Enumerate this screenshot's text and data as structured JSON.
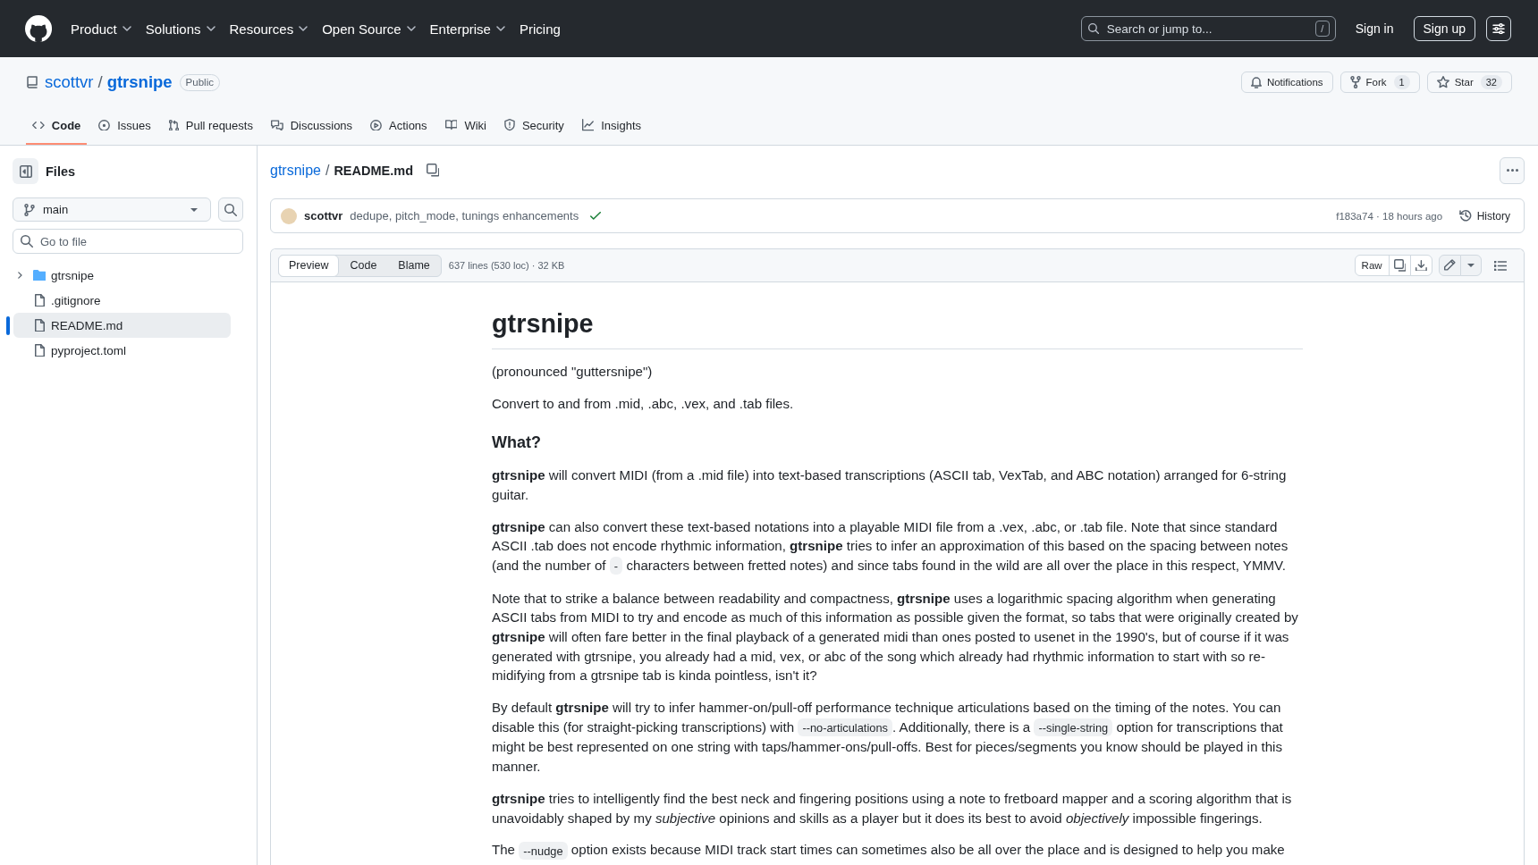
{
  "header": {
    "nav": [
      {
        "label": "Product",
        "dropdown": true
      },
      {
        "label": "Solutions",
        "dropdown": true
      },
      {
        "label": "Resources",
        "dropdown": true
      },
      {
        "label": "Open Source",
        "dropdown": true
      },
      {
        "label": "Enterprise",
        "dropdown": true
      },
      {
        "label": "Pricing",
        "dropdown": false
      }
    ],
    "search": {
      "placeholder": "Search or jump to...",
      "shortcut": "/"
    },
    "sign_in": "Sign in",
    "sign_up": "Sign up"
  },
  "repo": {
    "owner": "scottvr",
    "separator": "/",
    "name": "gtrsnipe",
    "visibility": "Public",
    "actions": [
      {
        "kind": "notifications",
        "label": "Notifications"
      },
      {
        "kind": "fork",
        "label": "Fork",
        "count": "1"
      },
      {
        "kind": "star",
        "label": "Star",
        "count": "32"
      }
    ]
  },
  "tabs": [
    {
      "kind": "code",
      "label": "Code",
      "selected": true
    },
    {
      "kind": "issues",
      "label": "Issues",
      "selected": false
    },
    {
      "kind": "pull_requests",
      "label": "Pull requests",
      "selected": false
    },
    {
      "kind": "discussions",
      "label": "Discussions",
      "selected": false
    },
    {
      "kind": "actions",
      "label": "Actions",
      "selected": false
    },
    {
      "kind": "wiki",
      "label": "Wiki",
      "selected": false
    },
    {
      "kind": "security",
      "label": "Security",
      "selected": false
    },
    {
      "kind": "insights",
      "label": "Insights",
      "selected": false
    }
  ],
  "sidebar": {
    "title": "Files",
    "branch": "main",
    "filter": {
      "placeholder": "Go to file"
    },
    "tree": [
      {
        "kind": "folder",
        "name": "gtrsnipe",
        "expanded": false,
        "selected": false
      },
      {
        "kind": "file",
        "name": ".gitignore",
        "selected": false
      },
      {
        "kind": "file",
        "name": "README.md",
        "selected": true
      },
      {
        "kind": "file",
        "name": "pyproject.toml",
        "selected": false
      }
    ]
  },
  "file": {
    "breadcrumb": {
      "repo": "gtrsnipe",
      "separator": "/",
      "file": "README.md"
    },
    "commit": {
      "author": "scottvr",
      "message": "dedupe, pitch_mode, tunings enhancements",
      "checks_passed": true,
      "meta": "f183a74 · 18 hours ago",
      "history": "History"
    },
    "view_modes": [
      {
        "label": "Preview",
        "selected": true
      },
      {
        "label": "Code",
        "selected": false
      },
      {
        "label": "Blame",
        "selected": false
      }
    ],
    "stats": "637 lines (530 loc) · 32 KB",
    "raw": "Raw"
  },
  "readme": [
    {
      "kind": "h1",
      "text": "gtrsnipe"
    },
    {
      "kind": "p",
      "parts": [
        {
          "kind": "text",
          "text": "(pronounced \"guttersnipe\")"
        }
      ]
    },
    {
      "kind": "p",
      "parts": [
        {
          "kind": "text",
          "text": "Convert to and from .mid, .abc, .vex, and .tab files."
        }
      ]
    },
    {
      "kind": "h2",
      "text": "What?"
    },
    {
      "kind": "p",
      "parts": [
        {
          "kind": "text",
          "text": "**gtrsnipe** will convert MIDI (from a .mid file) into text-based transcriptions (ASCII tab, VexTab, and ABC notation) arranged for 6-string guitar."
        }
      ]
    },
    {
      "kind": "p",
      "parts": [
        {
          "kind": "text",
          "text": "**gtrsnipe** can also convert these text-based notations into a playable MIDI file from a .vex, .abc, or .tab file. Note that since standard ASCII .tab does not encode rhythmic information, **gtrsnipe** tries to infer an approximation of this based on the spacing between notes (and the number of "
        },
        {
          "kind": "code",
          "text": "-"
        },
        {
          "kind": "text",
          "text": " characters between fretted notes) and since tabs found in the wild are all over the place in this respect, YMMV."
        }
      ]
    },
    {
      "kind": "p",
      "parts": [
        {
          "kind": "text",
          "text": "Note that to strike a balance between readability and compactness, **gtrsnipe** uses a logarithmic spacing algorithm when generating ASCII tabs from MIDI to try and encode as much of this information as possible given the format, so tabs that were originally created by **gtrsnipe** will often fare better in the final playback of a generated midi than ones posted to usenet in the 1990's, but of course if it was generated with gtrsnipe, you already had a mid, vex, or abc of the song which already had rhythmic information to start with so re-midifying from a gtrsnipe tab is kinda pointless, isn't it?"
        }
      ]
    },
    {
      "kind": "p",
      "parts": [
        {
          "kind": "text",
          "text": "By default **gtrsnipe** will try to infer hammer-on/pull-off performance technique articulations based on the timing of the notes. You can disable this (for straight-picking transcriptions) with "
        },
        {
          "kind": "code",
          "text": "--no-articulations"
        },
        {
          "kind": "text",
          "text": ". Additionally, there is a "
        },
        {
          "kind": "code",
          "text": "--single-string"
        },
        {
          "kind": "text",
          "text": " option for transcriptions that might be best represented on one string with taps/hammer-ons/pull-offs. Best for pieces/segments you know should be played in this manner."
        }
      ]
    },
    {
      "kind": "p",
      "parts": [
        {
          "kind": "text",
          "text": "**gtrsnipe** tries to intelligently find the best neck and fingering positions using a note to fretboard mapper and a scoring algorithm that is unavoidably shaped by my *subjective* opinions and skills as a player but it does its best to avoid *objectively* impossible fingerings."
        }
      ]
    },
    {
      "kind": "p",
      "parts": [
        {
          "kind": "text",
          "text": "The "
        },
        {
          "kind": "code",
          "text": "--nudge"
        },
        {
          "kind": "text",
          "text": " option exists because MIDI track start times can sometimes also be all over the place and is designed to help you make"
        }
      ]
    }
  ]
}
